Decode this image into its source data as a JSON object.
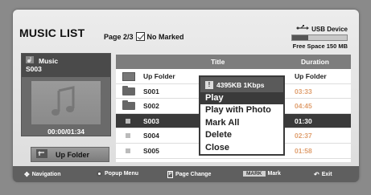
{
  "header": {
    "title": "MUSIC LIST",
    "page_info": "Page 2/3",
    "marked_label": "No Marked"
  },
  "device": {
    "label": "USB Device",
    "free_space": "Free Space 150 MB",
    "used_fraction": 0.3
  },
  "now_playing": {
    "category": "Music",
    "track": "S003",
    "time": "00:00/01:34"
  },
  "up_folder_button": "Up Folder",
  "list": {
    "columns": [
      "Title",
      "Duration"
    ],
    "rows": [
      {
        "name": "Up Folder",
        "duration": "Up Folder",
        "type": "up"
      },
      {
        "name": "S001",
        "duration": "03:33",
        "type": "folder"
      },
      {
        "name": "S002",
        "duration": "04:45",
        "type": "folder"
      },
      {
        "name": "S003",
        "duration": "01:30",
        "type": "file"
      },
      {
        "name": "S004",
        "duration": "02:37",
        "type": "file"
      },
      {
        "name": "S005",
        "duration": "01:58",
        "type": "file"
      }
    ],
    "selected_index": 3
  },
  "popup": {
    "info": "4395KB 1Kbps",
    "items": [
      "Play",
      "Play with Photo",
      "Mark All",
      "Delete",
      "Close"
    ],
    "active_index": 0
  },
  "footer": {
    "navigation": "Navigation",
    "popup_menu": "Popup Menu",
    "page_change": "Page Change",
    "mark_key": "MARK",
    "mark": "Mark",
    "exit": "Exit"
  }
}
